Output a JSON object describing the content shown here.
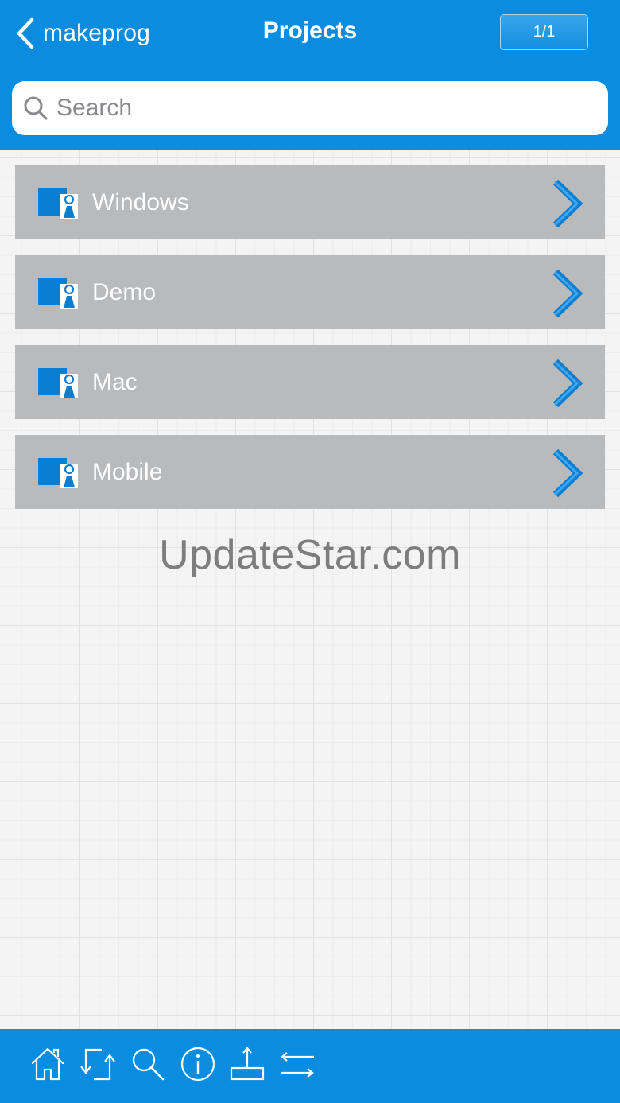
{
  "header": {
    "back_label": "makeprog",
    "title": "Projects",
    "pager": "1/1"
  },
  "search": {
    "placeholder": "Search",
    "value": ""
  },
  "projects": [
    {
      "label": "Windows"
    },
    {
      "label": "Demo"
    },
    {
      "label": "Mac"
    },
    {
      "label": "Mobile"
    }
  ],
  "watermark": "UpdateStar.com",
  "toolbar": {
    "icons": [
      "home-icon",
      "refresh-icon",
      "search-icon",
      "info-icon",
      "upload-icon",
      "swap-icon"
    ]
  },
  "colors": {
    "accent": "#0a8de0",
    "list_item_bg": "#b9babc",
    "icon_blue": "#0a7fd2"
  }
}
